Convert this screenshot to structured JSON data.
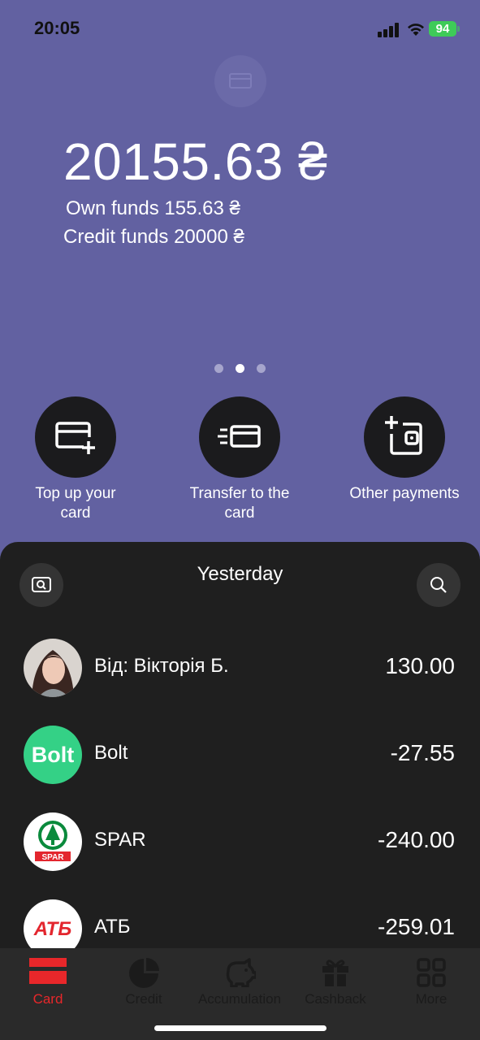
{
  "status_bar": {
    "time": "20:05",
    "battery": "94"
  },
  "balance": {
    "total": "20155.63 ₴",
    "own_funds": "Own funds 155.63 ₴",
    "credit_funds": "Credit funds 20000 ₴"
  },
  "carousel": {
    "count": 3,
    "active_index": 1
  },
  "actions": [
    {
      "label": "Top up your card",
      "icon": "card-plus-icon"
    },
    {
      "label": "Transfer to the card",
      "icon": "card-transfer-icon"
    },
    {
      "label": "Other payments",
      "icon": "wallet-plus-icon"
    }
  ],
  "transactions": {
    "section_title": "Yesterday",
    "items": [
      {
        "name": "Від: Вікторія Б.",
        "amount": "130.00",
        "icon": "person-avatar"
      },
      {
        "name": "Bolt",
        "amount": "-27.55",
        "logo_text": "Bolt"
      },
      {
        "name": "SPAR",
        "amount": "-240.00",
        "logo_text": "SPAR"
      },
      {
        "name": "АТБ",
        "amount": "-259.01",
        "logo_text": "АТБ"
      }
    ]
  },
  "tabs": [
    {
      "label": "Card",
      "active": true
    },
    {
      "label": "Credit",
      "active": false
    },
    {
      "label": "Accumulation",
      "active": false
    },
    {
      "label": "Cashback",
      "active": false
    },
    {
      "label": "More",
      "active": false
    }
  ],
  "colors": {
    "header_bg": "#6261a1",
    "sheet_bg": "#1f1f1f",
    "accent_active": "#e8272a",
    "bolt_green": "#34d186",
    "atb_red": "#e3262e",
    "spar_green": "#0a8a3c"
  }
}
